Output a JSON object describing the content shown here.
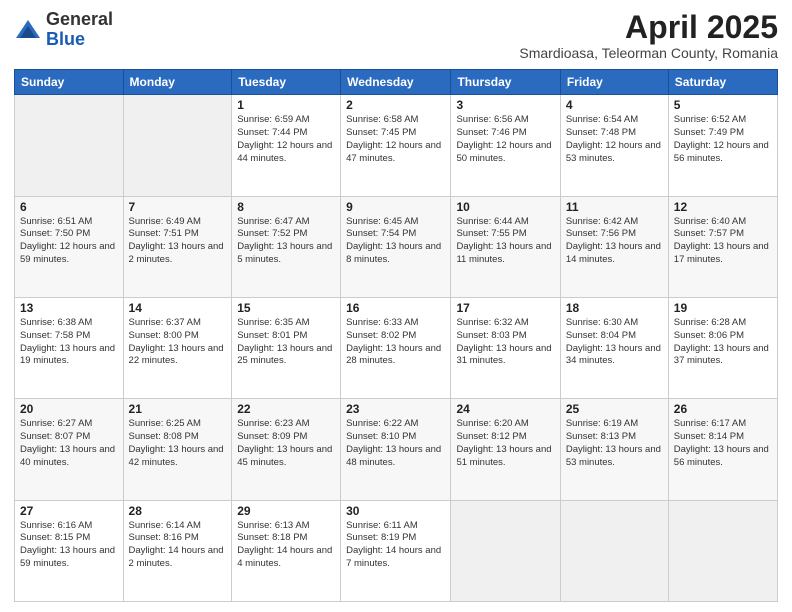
{
  "logo": {
    "general": "General",
    "blue": "Blue"
  },
  "title": "April 2025",
  "subtitle": "Smardioasa, Teleorman County, Romania",
  "days_of_week": [
    "Sunday",
    "Monday",
    "Tuesday",
    "Wednesday",
    "Thursday",
    "Friday",
    "Saturday"
  ],
  "weeks": [
    [
      {
        "day": "",
        "info": ""
      },
      {
        "day": "",
        "info": ""
      },
      {
        "day": "1",
        "info": "Sunrise: 6:59 AM\nSunset: 7:44 PM\nDaylight: 12 hours and 44 minutes."
      },
      {
        "day": "2",
        "info": "Sunrise: 6:58 AM\nSunset: 7:45 PM\nDaylight: 12 hours and 47 minutes."
      },
      {
        "day": "3",
        "info": "Sunrise: 6:56 AM\nSunset: 7:46 PM\nDaylight: 12 hours and 50 minutes."
      },
      {
        "day": "4",
        "info": "Sunrise: 6:54 AM\nSunset: 7:48 PM\nDaylight: 12 hours and 53 minutes."
      },
      {
        "day": "5",
        "info": "Sunrise: 6:52 AM\nSunset: 7:49 PM\nDaylight: 12 hours and 56 minutes."
      }
    ],
    [
      {
        "day": "6",
        "info": "Sunrise: 6:51 AM\nSunset: 7:50 PM\nDaylight: 12 hours and 59 minutes."
      },
      {
        "day": "7",
        "info": "Sunrise: 6:49 AM\nSunset: 7:51 PM\nDaylight: 13 hours and 2 minutes."
      },
      {
        "day": "8",
        "info": "Sunrise: 6:47 AM\nSunset: 7:52 PM\nDaylight: 13 hours and 5 minutes."
      },
      {
        "day": "9",
        "info": "Sunrise: 6:45 AM\nSunset: 7:54 PM\nDaylight: 13 hours and 8 minutes."
      },
      {
        "day": "10",
        "info": "Sunrise: 6:44 AM\nSunset: 7:55 PM\nDaylight: 13 hours and 11 minutes."
      },
      {
        "day": "11",
        "info": "Sunrise: 6:42 AM\nSunset: 7:56 PM\nDaylight: 13 hours and 14 minutes."
      },
      {
        "day": "12",
        "info": "Sunrise: 6:40 AM\nSunset: 7:57 PM\nDaylight: 13 hours and 17 minutes."
      }
    ],
    [
      {
        "day": "13",
        "info": "Sunrise: 6:38 AM\nSunset: 7:58 PM\nDaylight: 13 hours and 19 minutes."
      },
      {
        "day": "14",
        "info": "Sunrise: 6:37 AM\nSunset: 8:00 PM\nDaylight: 13 hours and 22 minutes."
      },
      {
        "day": "15",
        "info": "Sunrise: 6:35 AM\nSunset: 8:01 PM\nDaylight: 13 hours and 25 minutes."
      },
      {
        "day": "16",
        "info": "Sunrise: 6:33 AM\nSunset: 8:02 PM\nDaylight: 13 hours and 28 minutes."
      },
      {
        "day": "17",
        "info": "Sunrise: 6:32 AM\nSunset: 8:03 PM\nDaylight: 13 hours and 31 minutes."
      },
      {
        "day": "18",
        "info": "Sunrise: 6:30 AM\nSunset: 8:04 PM\nDaylight: 13 hours and 34 minutes."
      },
      {
        "day": "19",
        "info": "Sunrise: 6:28 AM\nSunset: 8:06 PM\nDaylight: 13 hours and 37 minutes."
      }
    ],
    [
      {
        "day": "20",
        "info": "Sunrise: 6:27 AM\nSunset: 8:07 PM\nDaylight: 13 hours and 40 minutes."
      },
      {
        "day": "21",
        "info": "Sunrise: 6:25 AM\nSunset: 8:08 PM\nDaylight: 13 hours and 42 minutes."
      },
      {
        "day": "22",
        "info": "Sunrise: 6:23 AM\nSunset: 8:09 PM\nDaylight: 13 hours and 45 minutes."
      },
      {
        "day": "23",
        "info": "Sunrise: 6:22 AM\nSunset: 8:10 PM\nDaylight: 13 hours and 48 minutes."
      },
      {
        "day": "24",
        "info": "Sunrise: 6:20 AM\nSunset: 8:12 PM\nDaylight: 13 hours and 51 minutes."
      },
      {
        "day": "25",
        "info": "Sunrise: 6:19 AM\nSunset: 8:13 PM\nDaylight: 13 hours and 53 minutes."
      },
      {
        "day": "26",
        "info": "Sunrise: 6:17 AM\nSunset: 8:14 PM\nDaylight: 13 hours and 56 minutes."
      }
    ],
    [
      {
        "day": "27",
        "info": "Sunrise: 6:16 AM\nSunset: 8:15 PM\nDaylight: 13 hours and 59 minutes."
      },
      {
        "day": "28",
        "info": "Sunrise: 6:14 AM\nSunset: 8:16 PM\nDaylight: 14 hours and 2 minutes."
      },
      {
        "day": "29",
        "info": "Sunrise: 6:13 AM\nSunset: 8:18 PM\nDaylight: 14 hours and 4 minutes."
      },
      {
        "day": "30",
        "info": "Sunrise: 6:11 AM\nSunset: 8:19 PM\nDaylight: 14 hours and 7 minutes."
      },
      {
        "day": "",
        "info": ""
      },
      {
        "day": "",
        "info": ""
      },
      {
        "day": "",
        "info": ""
      }
    ]
  ]
}
